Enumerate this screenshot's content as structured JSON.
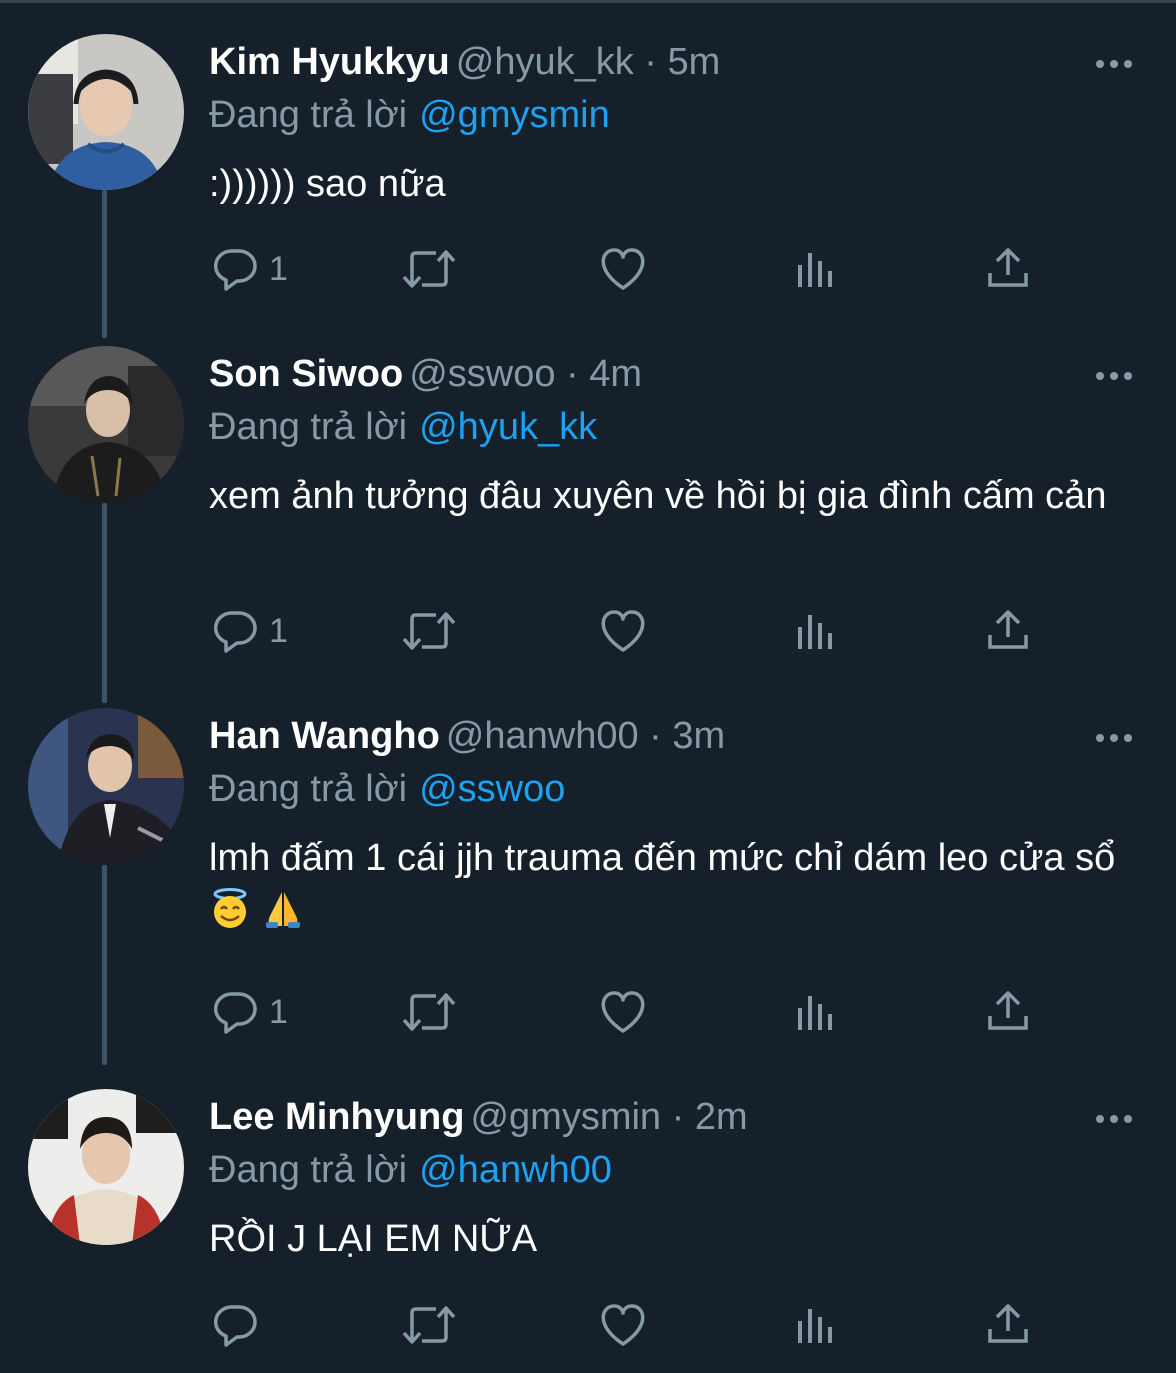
{
  "tweets": [
    {
      "name": "Kim Hyukkyu",
      "meta": "@hyuk_kk · 5m",
      "reply_label": "Đang trả lời",
      "reply_handle": "@gmysmin",
      "text": ":)))))) sao nữa",
      "reply_count": "1"
    },
    {
      "name": "Son Siwoo",
      "meta": "@sswoo · 4m",
      "reply_label": "Đang trả lời",
      "reply_handle": "@hyuk_kk",
      "text": "xem ảnh tưởng đâu xuyên về hồi bị gia đình cấm cản",
      "reply_count": "1"
    },
    {
      "name": "Han Wangho",
      "meta": "@hanwh00 · 3m",
      "reply_label": "Đang trả lời",
      "reply_handle": "@sswoo",
      "text": "lmh đấm 1 cái jjh trauma đến mức chỉ dám leo cửa sổ",
      "reply_count": "1"
    },
    {
      "name": "Lee Minhyung",
      "meta": "@gmysmin · 2m",
      "reply_label": "Đang trả lời",
      "reply_handle": "@hanwh00",
      "text": "RỒI J LẠI EM NỮA",
      "reply_count": ""
    }
  ],
  "icons": [
    "more-icon",
    "reply-icon",
    "retweet-icon",
    "like-icon",
    "analytics-icon",
    "share-icon",
    "smiling-face-with-halo-emoji",
    "folded-hands-emoji"
  ],
  "colors": {
    "background": "#15202b",
    "text": "#ffffff",
    "secondary": "#8899a6",
    "link": "#1da1f2",
    "thread_line": "#3d5466"
  }
}
